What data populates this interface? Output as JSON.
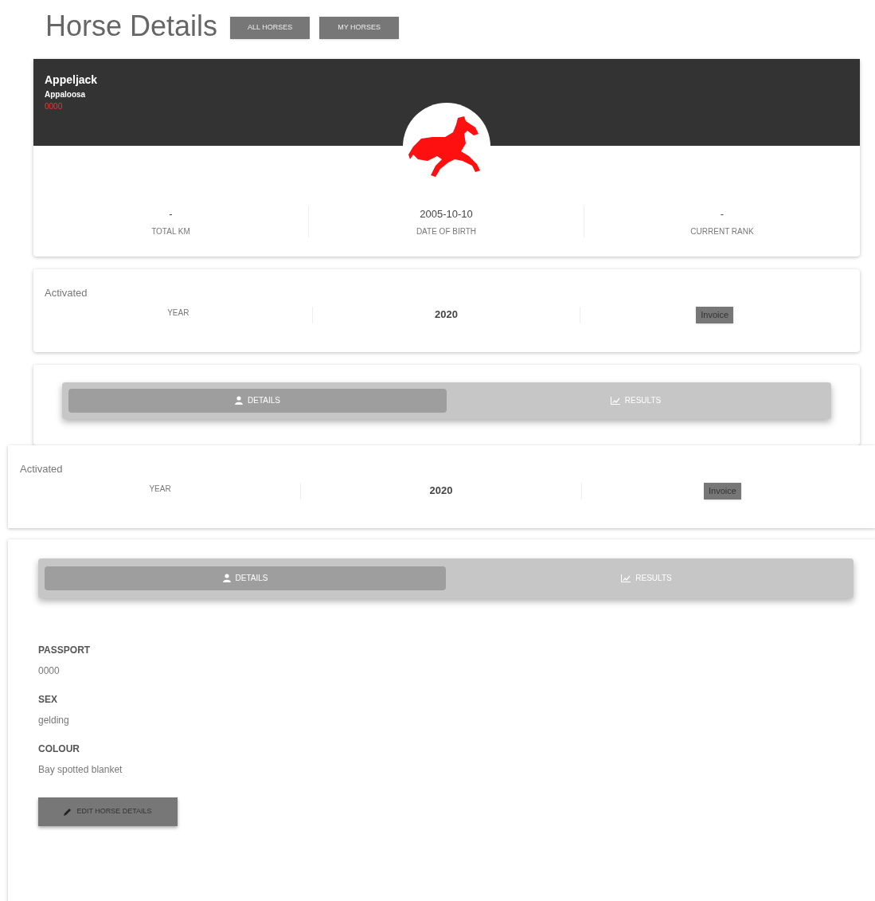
{
  "page_title": "Horse Details",
  "nav_buttons": [
    "ALL HORSES",
    "MY HORSES"
  ],
  "top_view": {
    "horse": {
      "name": "Appeljack",
      "breed": "Appaloosa",
      "code": "0000"
    },
    "stats": [
      {
        "value": "-",
        "label": "TOTAL KM"
      },
      {
        "value": "2005-10-10",
        "label": "DATE OF BIRTH"
      },
      {
        "value": "-",
        "label": "CURRENT RANK"
      }
    ],
    "activation": {
      "status": "Activated",
      "year_label": "YEAR",
      "year": "2020",
      "button": "Invoice"
    },
    "tabs": [
      {
        "label": "DETAILS",
        "kind": "user",
        "selected": true
      },
      {
        "label": "RESULTS",
        "kind": "chart",
        "selected": false
      }
    ]
  },
  "bottom_view": {
    "activation": {
      "status": "Activated",
      "year_label": "YEAR",
      "year": "2020",
      "button": "Invoice"
    },
    "tabs": [
      {
        "label": "DETAILS",
        "kind": "user",
        "selected": true
      },
      {
        "label": "RESULTS",
        "kind": "chart",
        "selected": false
      }
    ],
    "fields": [
      {
        "label": "PASSPORT",
        "value": "0000"
      },
      {
        "label": "SEX",
        "value": "gelding"
      },
      {
        "label": "COLOUR",
        "value": "Bay spotted blanket"
      }
    ],
    "edit_button": "EDIT HORSE DETAILS"
  }
}
